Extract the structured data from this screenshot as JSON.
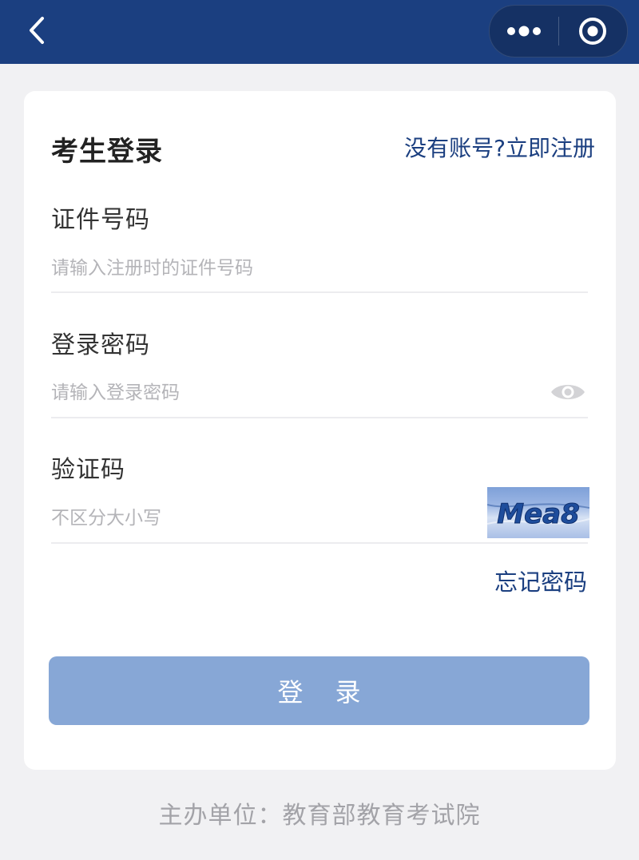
{
  "nav": {
    "back_icon": "chevron-left-icon",
    "more_icon": "more-dots-icon",
    "close_icon": "target-circle-icon",
    "bar_color": "#1b3f80"
  },
  "login": {
    "title": "考生登录",
    "register_link": "没有账号?立即注册",
    "id_field": {
      "label": "证件号码",
      "value": "",
      "placeholder": "请输入注册时的证件号码"
    },
    "password_field": {
      "label": "登录密码",
      "value": "",
      "placeholder": "请输入登录密码",
      "toggle_icon": "eye-icon"
    },
    "captcha_field": {
      "label": "验证码",
      "value": "",
      "placeholder": "不区分大小写",
      "captcha_text": "Mea8"
    },
    "forgot_link": "忘记密码",
    "submit_label": "登录",
    "submit_color": "#87a7d6"
  },
  "footer": {
    "organizer": "主办单位：教育部教育考试院"
  }
}
